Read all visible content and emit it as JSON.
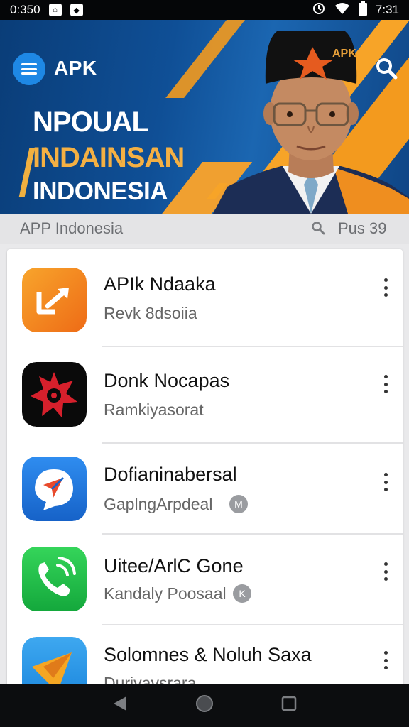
{
  "status_bar": {
    "time_left": "0:350",
    "time_right": "7:31",
    "icons": [
      "home-notification-icon",
      "app-notification-icon",
      "sync-icon",
      "wifi-icon",
      "battery-icon"
    ]
  },
  "header": {
    "app_title": "APK",
    "headline_1": "NPOUAL",
    "headline_2": "INDAINSAN",
    "headline_3": "INDONESIA",
    "portrait_hat_text": "APK"
  },
  "subheader": {
    "title": "APP Indonesia",
    "count": "Pus 39"
  },
  "apps": [
    {
      "name": "APIk Ndaaka",
      "subtitle": "Revk 8dsoiia",
      "badge": null,
      "icon": "orange-arrow-icon"
    },
    {
      "name": "Donk Nocapas",
      "subtitle": "Ramkiyasorat",
      "badge": null,
      "icon": "red-star-icon"
    },
    {
      "name": "Dofianinabersal",
      "subtitle": "GaplngArpdeal",
      "badge": "M",
      "icon": "blue-chat-icon"
    },
    {
      "name": "Uitee/ArlC Gone",
      "subtitle": "Kandaly Poosaal",
      "badge": "K",
      "icon": "green-phone-icon"
    },
    {
      "name": "Solomnes & Noluh Saxa",
      "subtitle": "Duriyavsrara",
      "badge": null,
      "icon": "blue-triangle-icon"
    }
  ],
  "colors": {
    "banner_blue": "#0f4f96",
    "banner_orange": "#f39a1e",
    "menu_blue": "#1e88e5",
    "status_bar": "#050608",
    "nav_bar": "#0c0d0f"
  }
}
